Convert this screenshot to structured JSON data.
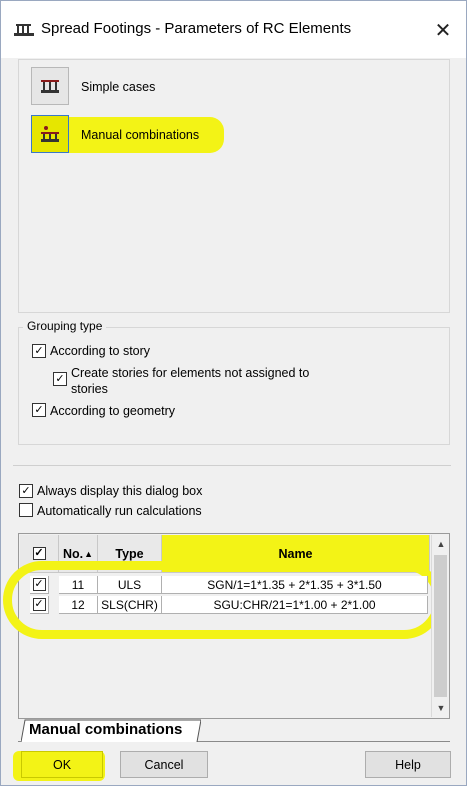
{
  "window": {
    "title": "Spread Footings - Parameters of RC Elements",
    "icon": "spread-footing-icon",
    "close_glyph": "✕"
  },
  "modes": [
    {
      "label": "Simple cases",
      "icon": "simple-cases-icon",
      "selected": false
    },
    {
      "label": "Manual combinations",
      "icon": "manual-combinations-icon",
      "selected": true
    }
  ],
  "grouping": {
    "title": "Grouping type",
    "according_to_story": {
      "label": "According to story",
      "checked": true
    },
    "create_stories": {
      "label_line1": "Create stories for elements not assigned to",
      "label_line2": "stories",
      "checked": true
    },
    "according_to_geometry": {
      "label": "According to geometry",
      "checked": true
    }
  },
  "options": {
    "always_display": {
      "label": "Always display this dialog box",
      "checked": true
    },
    "auto_run": {
      "label": "Automatically run calculations",
      "checked": false
    }
  },
  "table": {
    "columns": {
      "no": "No.",
      "type": "Type",
      "name": "Name"
    },
    "sort_glyph": "▲",
    "rows": [
      {
        "checked": true,
        "no": "11",
        "type": "ULS",
        "name": "SGN/1=1*1.35 + 2*1.35 + 3*1.50"
      },
      {
        "checked": true,
        "no": "12",
        "type": "SLS(CHR)",
        "name": "SGU:CHR/21=1*1.00 + 2*1.00"
      }
    ]
  },
  "tab": {
    "label": "Manual combinations"
  },
  "buttons": {
    "ok": "OK",
    "cancel": "Cancel",
    "help": "Help"
  },
  "colors": {
    "highlight": "#f3f316",
    "selected_border": "#3a78c8"
  }
}
